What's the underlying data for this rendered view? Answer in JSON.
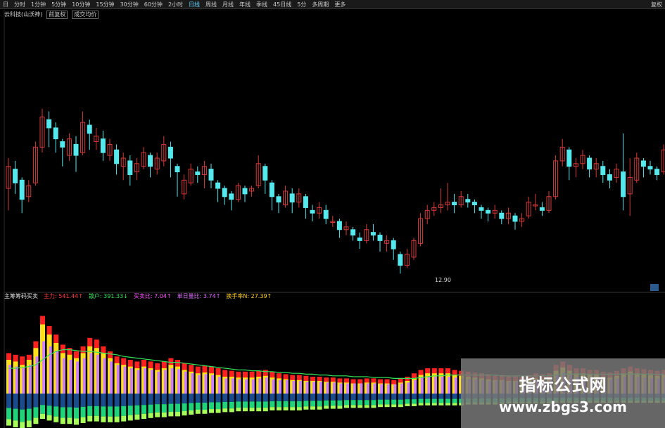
{
  "toolbar": {
    "items": [
      "日",
      "分时",
      "1分钟",
      "5分钟",
      "10分钟",
      "15分钟",
      "30分钟",
      "60分钟",
      "2小时",
      "日线",
      "周线",
      "月线",
      "年线",
      "季线",
      "45日线",
      "5分",
      "多周期",
      "更多"
    ],
    "active_index": 9,
    "right_label": "复权"
  },
  "sub_bar": {
    "left_label": "云科技(山沃神)",
    "chip1": "前复权",
    "chip2": "成交均价"
  },
  "indicator": {
    "name": "主筹筹码买卖",
    "zhuli": "主力: 541.44↑",
    "sanhu": "散户: 391.33↓",
    "maimaibi": "买卖比: 7.04↑",
    "danri": "单日量比: 3.74↑",
    "huanshou": "换手率N: 27.39↑"
  },
  "price_tag": "12.90",
  "watermark": {
    "line1": "指标公式网",
    "line2": "www.zbgs3.com"
  },
  "colors": {
    "up": "#d53a3a",
    "down": "#55e8ec",
    "main_line": "#33e35a"
  },
  "candles": [
    [
      11.8,
      12.6,
      11.2,
      12.9,
      11.0
    ],
    [
      12.5,
      12.0,
      11.7,
      12.8,
      11.6
    ],
    [
      12.1,
      11.4,
      11.1,
      12.2,
      10.9
    ],
    [
      11.5,
      11.9,
      11.4,
      12.1,
      11.3
    ],
    [
      12.0,
      13.3,
      12.0,
      13.5,
      11.9
    ],
    [
      13.3,
      14.4,
      13.2,
      14.7,
      13.1
    ],
    [
      14.3,
      14.0,
      13.5,
      14.6,
      13.3
    ],
    [
      14.0,
      13.6,
      13.4,
      14.2,
      13.1
    ],
    [
      13.5,
      13.3,
      12.8,
      13.6,
      12.6
    ],
    [
      13.0,
      13.6,
      13.0,
      13.8,
      12.8
    ],
    [
      13.4,
      13.0,
      12.6,
      13.7,
      12.4
    ],
    [
      13.1,
      14.2,
      13.1,
      14.6,
      13.0
    ],
    [
      14.1,
      13.8,
      13.4,
      14.3,
      13.2
    ],
    [
      13.5,
      13.7,
      13.3,
      14.0,
      13.2
    ],
    [
      13.6,
      13.1,
      13.0,
      13.9,
      12.8
    ],
    [
      13.0,
      13.4,
      12.9,
      13.6,
      12.8
    ],
    [
      13.2,
      12.7,
      12.4,
      13.4,
      12.3
    ],
    [
      12.6,
      12.9,
      12.2,
      13.1,
      12.1
    ],
    [
      12.8,
      12.3,
      12.1,
      13.0,
      11.9
    ],
    [
      12.4,
      12.7,
      12.2,
      12.9,
      12.1
    ],
    [
      12.6,
      13.1,
      12.6,
      13.3,
      12.5
    ],
    [
      13.0,
      12.6,
      12.3,
      13.1,
      12.2
    ],
    [
      12.5,
      12.9,
      12.4,
      13.1,
      12.3
    ],
    [
      12.8,
      13.4,
      12.8,
      13.7,
      12.6
    ],
    [
      13.3,
      12.9,
      12.4,
      13.5,
      12.2
    ],
    [
      12.6,
      12.4,
      11.6,
      12.7,
      11.5
    ],
    [
      11.6,
      12.1,
      11.6,
      12.3,
      11.4
    ],
    [
      12.0,
      12.5,
      12.0,
      12.7,
      11.9
    ],
    [
      12.4,
      12.3,
      12.1,
      12.6,
      12.0
    ],
    [
      12.3,
      12.6,
      12.0,
      12.8,
      11.8
    ],
    [
      12.5,
      12.1,
      11.9,
      12.7,
      11.8
    ],
    [
      12.0,
      11.8,
      11.5,
      12.1,
      11.3
    ],
    [
      11.8,
      11.5,
      11.3,
      11.9,
      11.2
    ],
    [
      11.6,
      11.4,
      11.1,
      11.7,
      11.0
    ],
    [
      11.4,
      11.9,
      11.4,
      12.0,
      11.3
    ],
    [
      11.8,
      11.6,
      11.4,
      11.9,
      11.3
    ],
    [
      11.7,
      11.8,
      11.6,
      11.9,
      11.5
    ],
    [
      11.9,
      12.7,
      11.9,
      13.0,
      11.8
    ],
    [
      12.6,
      12.1,
      11.8,
      12.7,
      11.6
    ],
    [
      12.0,
      11.5,
      11.2,
      12.1,
      11.0
    ],
    [
      11.5,
      11.3,
      11.0,
      11.6,
      10.9
    ],
    [
      11.2,
      11.7,
      11.2,
      11.9,
      11.1
    ],
    [
      11.6,
      11.3,
      11.0,
      11.8,
      10.9
    ],
    [
      11.3,
      11.6,
      11.2,
      11.8,
      11.1
    ],
    [
      11.5,
      11.1,
      10.8,
      11.6,
      10.7
    ],
    [
      11.0,
      10.9,
      10.7,
      11.2,
      10.6
    ],
    [
      10.9,
      11.1,
      10.8,
      11.3,
      10.7
    ],
    [
      11.0,
      10.7,
      10.6,
      11.2,
      10.5
    ],
    [
      10.6,
      10.6,
      10.5,
      10.8,
      10.4
    ],
    [
      10.6,
      10.3,
      10.1,
      10.7,
      10.0
    ],
    [
      10.3,
      10.4,
      10.2,
      10.6,
      10.1
    ],
    [
      10.3,
      10.1,
      10.0,
      10.4,
      9.9
    ],
    [
      10.0,
      9.9,
      9.8,
      10.2,
      9.6
    ],
    [
      9.9,
      10.3,
      9.9,
      10.5,
      9.8
    ],
    [
      10.2,
      10.1,
      10.0,
      10.5,
      9.9
    ],
    [
      10.1,
      9.9,
      9.7,
      10.2,
      9.5
    ],
    [
      9.8,
      9.9,
      9.6,
      10.1,
      9.5
    ],
    [
      9.9,
      9.6,
      9.3,
      10.0,
      9.2
    ],
    [
      9.4,
      9.0,
      8.8,
      9.5,
      8.7
    ],
    [
      9.0,
      9.4,
      9.0,
      9.6,
      8.9
    ],
    [
      9.3,
      9.9,
      9.3,
      10.0,
      9.2
    ],
    [
      9.8,
      10.7,
      9.8,
      10.9,
      9.7
    ],
    [
      10.7,
      11.0,
      10.6,
      11.2,
      10.5
    ],
    [
      11.0,
      11.1,
      10.9,
      11.3,
      10.8
    ],
    [
      11.1,
      11.2,
      11.0,
      11.8,
      10.9
    ],
    [
      11.2,
      11.3,
      11.1,
      12.0,
      11.0
    ],
    [
      11.3,
      11.2,
      11.0,
      11.6,
      10.9
    ],
    [
      11.2,
      11.5,
      11.2,
      11.7,
      11.1
    ],
    [
      11.4,
      11.3,
      11.2,
      11.6,
      11.1
    ],
    [
      11.3,
      11.2,
      11.0,
      11.4,
      10.9
    ],
    [
      11.1,
      11.0,
      10.8,
      11.2,
      10.7
    ],
    [
      11.0,
      10.9,
      10.7,
      11.1,
      10.6
    ],
    [
      10.9,
      11.0,
      10.8,
      11.2,
      10.7
    ],
    [
      10.9,
      10.7,
      10.6,
      11.0,
      10.5
    ],
    [
      10.7,
      10.9,
      10.6,
      11.1,
      10.5
    ],
    [
      10.8,
      10.6,
      10.4,
      10.9,
      10.3
    ],
    [
      10.6,
      10.7,
      10.5,
      10.9,
      10.4
    ],
    [
      10.8,
      11.3,
      10.8,
      11.5,
      10.7
    ],
    [
      11.2,
      11.2,
      11.1,
      11.6,
      11.0
    ],
    [
      11.1,
      11.0,
      10.9,
      11.3,
      10.8
    ],
    [
      11.0,
      11.5,
      11.0,
      11.7,
      10.9
    ],
    [
      11.5,
      12.8,
      11.5,
      13.0,
      11.4
    ],
    [
      12.8,
      13.3,
      12.7,
      13.6,
      12.6
    ],
    [
      13.2,
      12.6,
      12.3,
      13.3,
      12.1
    ],
    [
      12.6,
      12.7,
      12.3,
      12.9,
      12.2
    ],
    [
      12.7,
      13.0,
      12.6,
      13.2,
      12.5
    ],
    [
      12.9,
      12.5,
      12.3,
      13.0,
      12.2
    ],
    [
      12.5,
      12.7,
      12.3,
      12.9,
      12.2
    ],
    [
      12.6,
      12.3,
      12.1,
      12.8,
      12.0
    ],
    [
      12.3,
      12.1,
      11.9,
      12.5,
      11.8
    ],
    [
      12.2,
      12.5,
      12.1,
      12.7,
      12.0
    ],
    [
      12.4,
      11.5,
      11.2,
      13.8,
      11.0
    ],
    [
      11.6,
      12.2,
      11.6,
      12.9,
      10.8
    ],
    [
      12.1,
      12.9,
      12.1,
      13.1,
      12.0
    ],
    [
      12.8,
      12.6,
      12.3,
      12.9,
      12.2
    ],
    [
      12.6,
      12.5,
      12.4,
      12.8,
      12.3
    ],
    [
      12.5,
      12.3,
      12.2,
      12.6,
      12.1
    ],
    [
      12.4,
      13.2,
      12.4,
      13.4,
      12.3
    ]
  ],
  "indicator_series": {
    "red": [
      48,
      46,
      44,
      46,
      62,
      92,
      80,
      70,
      58,
      54,
      50,
      56,
      66,
      64,
      56,
      50,
      44,
      42,
      40,
      38,
      40,
      38,
      36,
      38,
      42,
      40,
      36,
      34,
      32,
      33,
      32,
      30,
      28,
      27,
      26,
      26,
      26,
      27,
      28,
      26,
      24,
      23,
      22,
      22,
      21,
      20,
      20,
      19,
      19,
      18,
      18,
      17,
      17,
      18,
      18,
      17,
      17,
      16,
      18,
      20,
      24,
      28,
      30,
      30,
      30,
      30,
      28,
      27,
      26,
      25,
      24,
      23,
      22,
      22,
      21,
      21,
      20,
      22,
      24,
      23,
      24,
      34,
      38,
      34,
      30,
      30,
      28,
      28,
      26,
      25,
      27,
      30,
      32,
      30,
      29,
      28,
      27,
      28
    ],
    "yellow": [
      40,
      38,
      34,
      40,
      54,
      82,
      70,
      60,
      48,
      46,
      42,
      48,
      56,
      54,
      48,
      42,
      36,
      34,
      32,
      30,
      32,
      30,
      28,
      30,
      34,
      32,
      28,
      26,
      24,
      25,
      24,
      22,
      20,
      20,
      19,
      19,
      19,
      20,
      21,
      19,
      18,
      17,
      16,
      16,
      15,
      15,
      15,
      14,
      14,
      13,
      13,
      12,
      12,
      13,
      13,
      12,
      12,
      11,
      13,
      15,
      18,
      22,
      24,
      24,
      24,
      24,
      22,
      21,
      20,
      19,
      18,
      17,
      16,
      16,
      15,
      15,
      14,
      16,
      18,
      17,
      18,
      27,
      31,
      27,
      24,
      24,
      22,
      22,
      20,
      19,
      21,
      24,
      26,
      24,
      23,
      22,
      21,
      22
    ],
    "violet": [
      34,
      32,
      30,
      34,
      44,
      62,
      56,
      50,
      42,
      40,
      38,
      42,
      48,
      46,
      42,
      38,
      34,
      32,
      30,
      28,
      30,
      28,
      26,
      28,
      30,
      29,
      26,
      24,
      22,
      23,
      22,
      20,
      18,
      18,
      17,
      17,
      17,
      18,
      19,
      17,
      16,
      16,
      15,
      15,
      14,
      14,
      14,
      13,
      13,
      12,
      12,
      12,
      12,
      12,
      12,
      11,
      11,
      11,
      12,
      13,
      16,
      19,
      20,
      20,
      20,
      20,
      19,
      18,
      17,
      17,
      16,
      15,
      15,
      15,
      14,
      14,
      13,
      14,
      16,
      15,
      16,
      22,
      25,
      22,
      20,
      20,
      19,
      19,
      18,
      17,
      18,
      20,
      22,
      20,
      19,
      18,
      18,
      19
    ],
    "neg": [
      38,
      40,
      42,
      40,
      36,
      30,
      32,
      34,
      36,
      36,
      37,
      35,
      33,
      33,
      34,
      34,
      34,
      33,
      32,
      31,
      30,
      29,
      28,
      28,
      27,
      27,
      26,
      25,
      24,
      24,
      23,
      23,
      22,
      22,
      21,
      21,
      21,
      21,
      21,
      20,
      20,
      20,
      20,
      20,
      19,
      19,
      19,
      18,
      18,
      18,
      17,
      17,
      17,
      17,
      17,
      16,
      16,
      16,
      16,
      15,
      15,
      14,
      14,
      14,
      14,
      14,
      14,
      14,
      13,
      13,
      13,
      13,
      13,
      13,
      12,
      12,
      12,
      12,
      12,
      12,
      12,
      11,
      11,
      11,
      11,
      11,
      11,
      11,
      11,
      11,
      11,
      11,
      11,
      11,
      11,
      11,
      11,
      11
    ],
    "green_line": [
      30,
      30,
      31,
      32,
      34,
      40,
      46,
      50,
      52,
      52,
      51,
      50,
      50,
      49,
      48,
      47,
      46,
      44,
      43,
      42,
      41,
      40,
      39,
      38,
      37,
      37,
      36,
      35,
      34,
      33,
      32,
      31,
      30,
      29,
      28,
      28,
      27,
      27,
      26,
      26,
      25,
      25,
      24,
      24,
      23,
      23,
      22,
      22,
      21,
      21,
      21,
      20,
      20,
      20,
      19,
      19,
      19,
      18,
      18,
      18,
      18,
      19,
      20,
      21,
      21,
      22,
      22,
      22,
      22,
      22,
      22,
      22,
      22,
      21,
      21,
      21,
      21,
      21,
      21,
      21,
      21,
      22,
      23,
      23,
      23,
      23,
      23,
      23,
      23,
      23,
      23,
      23,
      23,
      23,
      23,
      23,
      23,
      23
    ]
  }
}
